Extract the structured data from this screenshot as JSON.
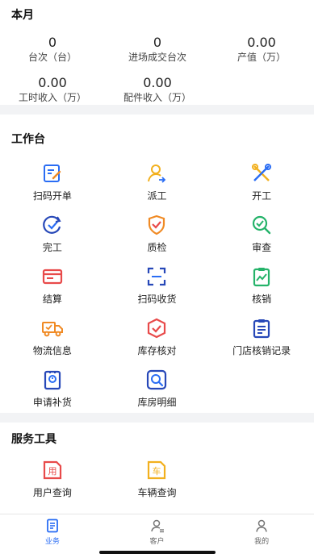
{
  "month": {
    "title": "本月",
    "stats": [
      {
        "value": "0",
        "label": "台次（台）"
      },
      {
        "value": "0",
        "label": "进场成交台次"
      },
      {
        "value": "0.00",
        "label": "产值（万）"
      },
      {
        "value": "0.00",
        "label": "工时收入（万）"
      },
      {
        "value": "0.00",
        "label": "配件收入（万）"
      }
    ]
  },
  "workbench": {
    "title": "工作台",
    "items": [
      {
        "label": "扫码开单",
        "icon": "scan-order-icon"
      },
      {
        "label": "派工",
        "icon": "dispatch-person-icon"
      },
      {
        "label": "开工",
        "icon": "tools-icon"
      },
      {
        "label": "完工",
        "icon": "complete-check-icon"
      },
      {
        "label": "质检",
        "icon": "quality-shield-icon"
      },
      {
        "label": "审查",
        "icon": "review-search-icon"
      },
      {
        "label": "结算",
        "icon": "settlement-card-icon"
      },
      {
        "label": "扫码收货",
        "icon": "scan-frame-icon"
      },
      {
        "label": "核销",
        "icon": "writeoff-clipboard-icon"
      },
      {
        "label": "物流信息",
        "icon": "truck-icon"
      },
      {
        "label": "库存核对",
        "icon": "inventory-check-icon"
      },
      {
        "label": "门店核销记录",
        "icon": "store-record-icon"
      },
      {
        "label": "申请补货",
        "icon": "restock-icon"
      },
      {
        "label": "库房明细",
        "icon": "warehouse-detail-icon"
      }
    ]
  },
  "service_tools": {
    "title": "服务工具",
    "items": [
      {
        "label": "用户查询",
        "icon": "user-query-icon",
        "glyph": "用"
      },
      {
        "label": "车辆查询",
        "icon": "vehicle-query-icon",
        "glyph": "车"
      }
    ]
  },
  "tabbar": {
    "tabs": [
      {
        "label": "业务",
        "active": true
      },
      {
        "label": "客户",
        "active": false
      },
      {
        "label": "我的",
        "active": false
      }
    ]
  },
  "colors": {
    "blue": "#2a6df4",
    "orange": "#f08a24",
    "red": "#e84a4a",
    "green": "#25b36a",
    "yellow": "#f2b01e",
    "navy": "#2748b8"
  }
}
